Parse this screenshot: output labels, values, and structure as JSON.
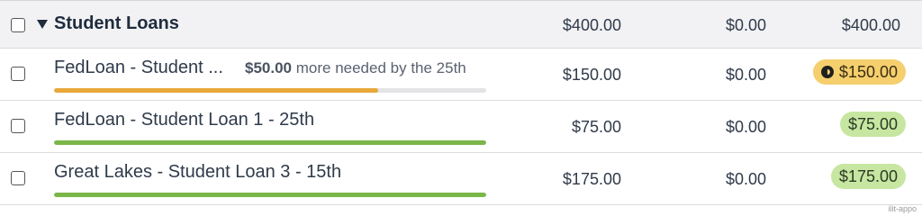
{
  "group": {
    "name": "Student Loans",
    "budgeted": "$400.00",
    "activity": "$0.00",
    "available": "$400.00"
  },
  "items": [
    {
      "name": "FedLoan - Student ...",
      "funded_amount": "$50.00",
      "funded_text": "more needed by the 25th",
      "budgeted": "$150.00",
      "activity": "$0.00",
      "available": "$150.00",
      "progress": 0.75,
      "status": "underfunded"
    },
    {
      "name": "FedLoan - Student Loan 1 - 25th",
      "budgeted": "$75.00",
      "activity": "$0.00",
      "available": "$75.00",
      "progress": 1.0,
      "status": "funded"
    },
    {
      "name": "Great Lakes - Student Loan 3 - 15th",
      "budgeted": "$175.00",
      "activity": "$0.00",
      "available": "$175.00",
      "progress": 1.0,
      "status": "funded"
    }
  ],
  "colors": {
    "warning": "#e8a93a",
    "funded": "#7ab648",
    "warning_pill": "#f5cf6e",
    "funded_pill": "#c7e6a1"
  },
  "watermark": "ilit-appo"
}
